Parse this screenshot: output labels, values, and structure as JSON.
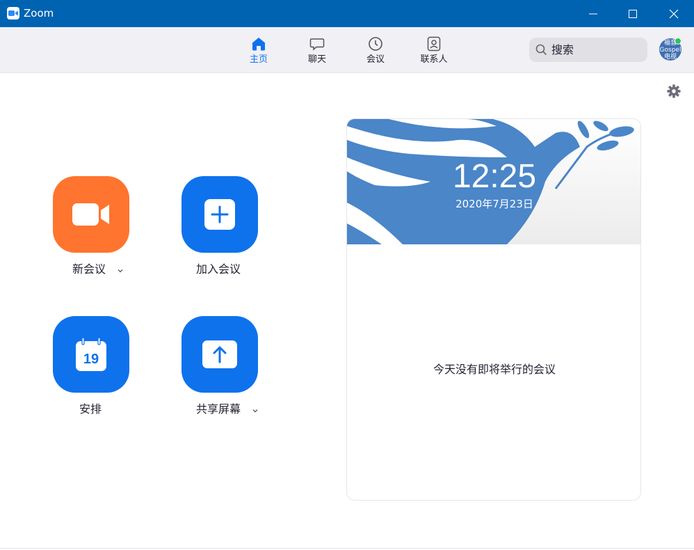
{
  "window": {
    "title": "Zoom",
    "minimize_glyph": "—",
    "maximize_glyph": "☐",
    "close_glyph": "✕"
  },
  "nav": {
    "tabs": [
      {
        "label": "主页",
        "icon": "home-icon",
        "active": true
      },
      {
        "label": "聊天",
        "icon": "chat-icon",
        "active": false
      },
      {
        "label": "会议",
        "icon": "clock-icon",
        "active": false
      },
      {
        "label": "联系人",
        "icon": "contact-icon",
        "active": false
      }
    ],
    "active_color": "#0e72ed"
  },
  "search": {
    "placeholder": "搜索"
  },
  "avatar": {
    "text": "福音Gospel电视"
  },
  "actions": [
    {
      "label": "新会议",
      "icon": "video-camera-icon",
      "color": "#ff742e",
      "has_dropdown": true
    },
    {
      "label": "加入会议",
      "icon": "plus-icon",
      "color": "#0e72ed",
      "has_dropdown": false
    },
    {
      "label": "安排",
      "icon": "calendar-icon",
      "calendar_day": "19",
      "color": "#0e72ed",
      "has_dropdown": false
    },
    {
      "label": "共享屏幕",
      "icon": "share-screen-icon",
      "color": "#0e72ed",
      "has_dropdown": true
    }
  ],
  "meeting_card": {
    "time": "12:25",
    "date": "2020年7月23日",
    "empty_message": "今天没有即将举行的会议",
    "banner_color": "#4a86c8"
  },
  "colors": {
    "titlebar": "#0063b1",
    "toolbar": "#f0f0f5",
    "brand_blue": "#0e72ed",
    "orange": "#ff742e"
  }
}
